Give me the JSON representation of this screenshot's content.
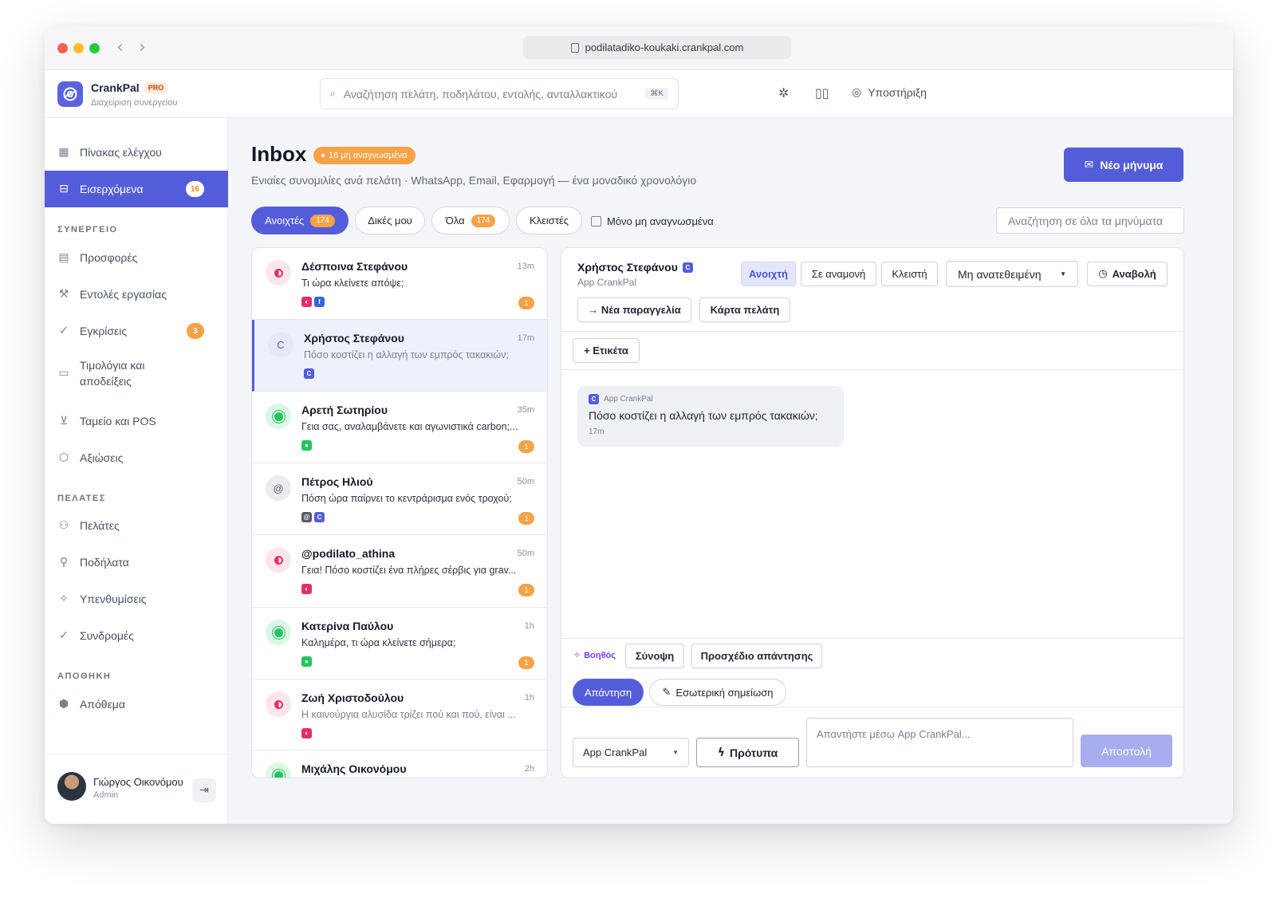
{
  "browser": {
    "url": "podilatadiko-koukaki.crankpal.com"
  },
  "app": {
    "name": "CrankPal",
    "plan": "PRO",
    "subtitle": "Διαχείριση συνεργείου"
  },
  "search": {
    "placeholder": "Αναζήτηση πελάτη, ποδηλάτου, εντολής, ανταλλακτικού",
    "shortcut": "⌘K"
  },
  "topbar": {
    "support": "Υποστήριξη"
  },
  "sidebar": {
    "items": [
      {
        "label": "Πίνακας ελέγχου",
        "icon": "grid-icon"
      },
      {
        "label": "Εισερχόμενα",
        "badge": "16",
        "icon": "inbox-icon"
      }
    ],
    "section_workshop": "ΣΥΝΕΡΓΕΙΟ",
    "workshop": [
      {
        "label": "Προσφορές",
        "icon": "document-icon"
      },
      {
        "label": "Εντολές εργασίας",
        "icon": "wrench-icon"
      },
      {
        "label": "Εγκρίσεις",
        "badge": "3",
        "icon": "check-circle-icon"
      },
      {
        "label": "Τιμολόγια και αποδείξεις",
        "icon": "receipt-icon"
      },
      {
        "label": "Ταμείο και POS",
        "icon": "cart-icon"
      },
      {
        "label": "Αξιώσεις",
        "icon": "shield-icon"
      }
    ],
    "section_customers": "ΠΕΛΑΤΕΣ",
    "customers": [
      {
        "label": "Πελάτες",
        "icon": "users-icon"
      },
      {
        "label": "Ποδήλατα",
        "icon": "bike-icon"
      },
      {
        "label": "Υπενθυμίσεις",
        "icon": "sparkle-icon"
      },
      {
        "label": "Συνδρομές",
        "icon": "check-circle-icon"
      }
    ],
    "section_warehouse": "ΑΠΟΘΗΚΗ",
    "warehouse": [
      {
        "label": "Απόθεμα",
        "icon": "box-icon"
      }
    ],
    "user": {
      "name": "Γιώργος Οικονόμου",
      "role": "Admin"
    }
  },
  "inbox": {
    "title": "Inbox",
    "unread_badge": "16 μη αναγνωσμένα",
    "subtitle": "Ενιαίες συνομιλίες ανά πελάτη · WhatsApp, Email, Εφαρμογή — ένα μοναδικό χρονολόγιο",
    "new_message": "Νέο μήνυμα",
    "filters": [
      {
        "label": "Ανοιχτές",
        "count": "174"
      },
      {
        "label": "Δικές μου"
      },
      {
        "label": "Όλα",
        "count": "174"
      },
      {
        "label": "Κλειστές"
      }
    ],
    "unread_only": "Μόνο μη αναγνωσμένα",
    "search_placeholder": "Αναζήτηση σε όλα τα μηνύματα"
  },
  "conversations": [
    {
      "name": "Δέσποινα Στεφάνου",
      "time": "13m",
      "preview": "Τι ώρα κλείνετε απόψε;",
      "count": "1",
      "avatar": "instagram-icon",
      "chips": [
        "instagram-icon",
        "facebook-icon"
      ]
    },
    {
      "name": "Χρήστος Στεφάνου",
      "time": "17m",
      "preview": "Πόσο κοστίζει η αλλαγή των εμπρός τακακιών;",
      "avatar_text": "C",
      "chips": [
        "app-icon"
      ]
    },
    {
      "name": "Αρετή Σωτηρίου",
      "time": "35m",
      "preview": "Γεια σας, αναλαμβάνετε και αγωνιστικά carbon;...",
      "count": "1",
      "avatar": "whatsapp-icon",
      "chips": [
        "whatsapp-icon"
      ]
    },
    {
      "name": "Πέτρος Ηλιού",
      "time": "50m",
      "preview": "Πόση ώρα παίρνει το κεντράρισμα ενός τροχού;",
      "count": "1",
      "avatar_text": "@",
      "chips": [
        "email-icon",
        "app-icon"
      ]
    },
    {
      "name": "@podilato_athina",
      "time": "50m",
      "preview": "Γεια! Πόσο κοστίζει ένα πλήρες σέρβις για grav...",
      "count": "1",
      "avatar": "instagram-icon",
      "chips": [
        "instagram-icon"
      ]
    },
    {
      "name": "Κατερίνα Παύλου",
      "time": "1h",
      "preview": "Καλημέρα, τι ώρα κλείνετε σήμερα;",
      "count": "1",
      "avatar": "whatsapp-icon",
      "chips": [
        "whatsapp-icon"
      ]
    },
    {
      "name": "Ζωή Χριστοδούλου",
      "time": "1h",
      "preview": "Η καινούργια αλυσίδα τρίζει πού και πού, είναι ...",
      "avatar": "instagram-icon",
      "chips": [
        "instagram-icon"
      ]
    },
    {
      "name": "Μιχάλης Οικονόμου",
      "time": "2h",
      "avatar": "whatsapp-icon"
    }
  ],
  "thread": {
    "name": "Χρήστος Στεφάνου",
    "chip": "C",
    "source": "App CrankPal",
    "status": [
      "Ανοιχτή",
      "Σε αναμονή",
      "Κλειστή"
    ],
    "assignee": "Μη ανατεθειμένη",
    "snooze": "Αναβολή",
    "new_order": "→ Νέα παραγγελία",
    "customer_card": "Κάρτα πελάτη",
    "add_tag": "+ Ετικέτα",
    "message": {
      "source": "App CrankPal",
      "text": "Πόσο κοστίζει η αλλαγή των εμπρός τακακιών;",
      "time": "17m"
    },
    "assistant": "Βοηθός",
    "summary": "Σύνοψη",
    "draft": "Προσχέδιο απάντησης",
    "reply_tab": "Απάντηση",
    "note_tab": "Εσωτερική σημείωση",
    "channel": "App CrankPal",
    "templates": "Πρότυπα",
    "reply_placeholder": "Απαντήστε μέσω App CrankPal...",
    "send": "Αποστολή"
  },
  "colors": {
    "accent": "#545dd9",
    "badge": "#f4a347",
    "instagram": "#e1306c",
    "whatsapp": "#22c55e"
  }
}
